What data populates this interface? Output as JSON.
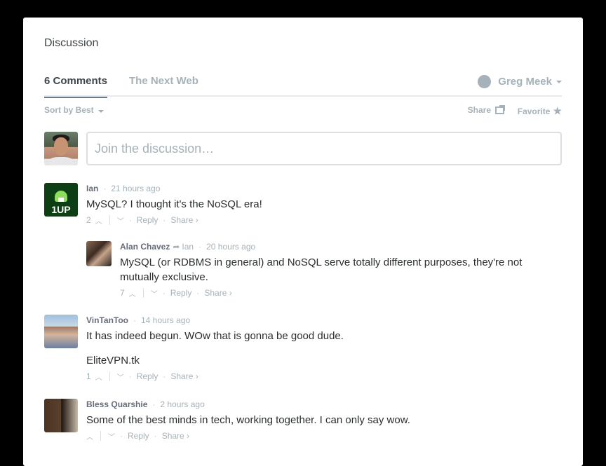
{
  "discussion_title": "Discussion",
  "nav": {
    "comments_tab": "6 Comments",
    "forum_tab": "The Next Web",
    "user_name": "Greg Meek"
  },
  "toolbar": {
    "sort_label": "Sort by Best",
    "share_label": "Share",
    "favorite_label": "Favorite"
  },
  "composer": {
    "placeholder": "Join the discussion…"
  },
  "posts": [
    {
      "author": "Ian",
      "time": "21 hours ago",
      "message": "MySQL? I thought it's the NoSQL era!",
      "votes": "2",
      "reply_label": "Reply",
      "share_label": "Share ›"
    },
    {
      "author": "Alan Chavez",
      "in_reply_to": "Ian",
      "time": "20 hours ago",
      "message": "MySQL (or RDBMS in general) and NoSQL serve totally different purposes, they're not mutually exclusive.",
      "votes": "7",
      "reply_label": "Reply",
      "share_label": "Share ›"
    },
    {
      "author": "VinTanToo",
      "time": "14 hours ago",
      "message": "It has indeed begun. WOw that is gonna be good dude.",
      "message2": "EliteVPN.tk",
      "votes": "1",
      "reply_label": "Reply",
      "share_label": "Share ›"
    },
    {
      "author": "Bless Quarshie",
      "time": "2 hours ago",
      "message": "Some of the best minds in tech, working together. I can only say wow.",
      "votes": "",
      "reply_label": "Reply",
      "share_label": "Share ›"
    }
  ],
  "oneup_label": "1UP",
  "colors": {
    "accent_text": "#656c7a",
    "muted": "#a5b2b9",
    "border": "#dbdfe4"
  }
}
